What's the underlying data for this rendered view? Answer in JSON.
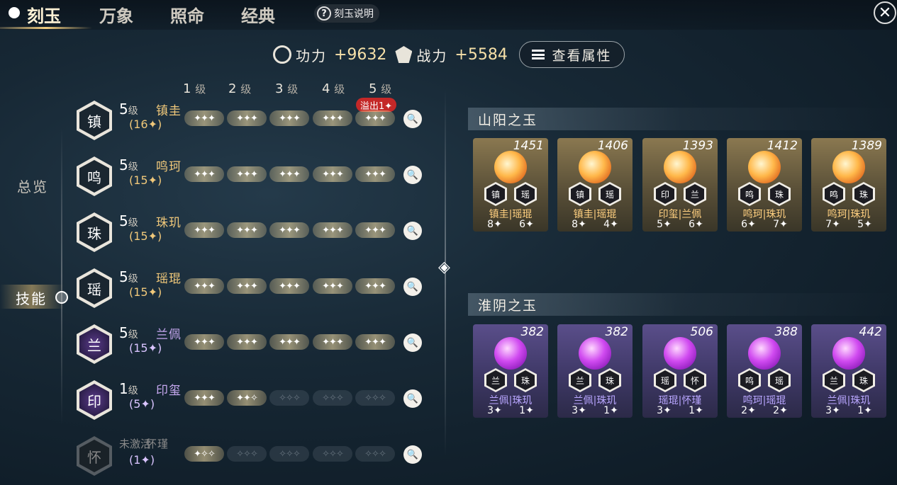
{
  "tabs": [
    {
      "label": "刻玉",
      "active": true
    },
    {
      "label": "万象",
      "active": false
    },
    {
      "label": "照命",
      "active": false
    },
    {
      "label": "经典",
      "active": false
    }
  ],
  "help_label": "刻玉说明",
  "help_icon": "?",
  "close_icon": "✕",
  "stats": {
    "gongli_label": "功力",
    "gongli_value": "+9632",
    "zhanli_label": "战力",
    "zhanli_value": "+5584",
    "attr_button": "查看属性"
  },
  "nav": {
    "overview": "总览",
    "skills": "技能"
  },
  "level_headers": [
    {
      "num": "1",
      "unit": "级"
    },
    {
      "num": "2",
      "unit": "级"
    },
    {
      "num": "3",
      "unit": "级"
    },
    {
      "num": "4",
      "unit": "级"
    },
    {
      "num": "5",
      "unit": "级"
    }
  ],
  "overflow_badge": "溢出1✦",
  "skills": [
    {
      "level": "5",
      "unit": "级",
      "name": "镇圭",
      "stars": "(16✦)",
      "filled": 15,
      "color": "gold",
      "active": true,
      "icon": "镇"
    },
    {
      "level": "5",
      "unit": "级",
      "name": "鸣珂",
      "stars": "(15✦)",
      "filled": 15,
      "color": "gold",
      "active": true,
      "icon": "鸣"
    },
    {
      "level": "5",
      "unit": "级",
      "name": "珠玑",
      "stars": "(15✦)",
      "filled": 15,
      "color": "gold",
      "active": true,
      "icon": "珠"
    },
    {
      "level": "5",
      "unit": "级",
      "name": "瑶琨",
      "stars": "(15✦)",
      "filled": 15,
      "color": "gold",
      "active": true,
      "icon": "瑶"
    },
    {
      "level": "5",
      "unit": "级",
      "name": "兰佩",
      "stars": "(15✦)",
      "filled": 15,
      "color": "purple",
      "active": true,
      "icon": "兰"
    },
    {
      "level": "1",
      "unit": "级",
      "name": "印玺",
      "stars": "(5✦)",
      "filled": 5,
      "color": "purple",
      "active": true,
      "icon": "印"
    },
    {
      "level": "未激活",
      "unit": "",
      "name": "怀瑾",
      "stars": "(1✦)",
      "filled": 1,
      "color": "purple",
      "active": false,
      "icon": "怀"
    }
  ],
  "groups": {
    "shanyang": {
      "title": "山阳之玉",
      "cards": [
        {
          "score": "1451",
          "a": "镇圭",
          "b": "瑶琨",
          "an": "8✦",
          "bn": "6✦",
          "ia": "镇",
          "ib": "瑶"
        },
        {
          "score": "1406",
          "a": "镇圭",
          "b": "瑶琨",
          "an": "8✦",
          "bn": "4✦",
          "ia": "镇",
          "ib": "瑶"
        },
        {
          "score": "1393",
          "a": "印玺",
          "b": "兰佩",
          "an": "5✦",
          "bn": "6✦",
          "ia": "印",
          "ib": "兰"
        },
        {
          "score": "1412",
          "a": "鸣珂",
          "b": "珠玑",
          "an": "6✦",
          "bn": "7✦",
          "ia": "鸣",
          "ib": "珠"
        },
        {
          "score": "1389",
          "a": "鸣珂",
          "b": "珠玑",
          "an": "7✦",
          "bn": "5✦",
          "ia": "鸣",
          "ib": "珠"
        }
      ]
    },
    "huaiyin": {
      "title": "淮阴之玉",
      "cards": [
        {
          "score": "382",
          "a": "兰佩",
          "b": "珠玑",
          "an": "3✦",
          "bn": "1✦",
          "ia": "兰",
          "ib": "珠"
        },
        {
          "score": "382",
          "a": "兰佩",
          "b": "珠玑",
          "an": "3✦",
          "bn": "1✦",
          "ia": "兰",
          "ib": "珠"
        },
        {
          "score": "506",
          "a": "瑶琨",
          "b": "怀瑾",
          "an": "3✦",
          "bn": "1✦",
          "ia": "瑶",
          "ib": "怀"
        },
        {
          "score": "388",
          "a": "鸣珂",
          "b": "瑶琨",
          "an": "2✦",
          "bn": "2✦",
          "ia": "鸣",
          "ib": "瑶"
        },
        {
          "score": "442",
          "a": "兰佩",
          "b": "珠玑",
          "an": "3✦",
          "bn": "1✦",
          "ia": "兰",
          "ib": "珠"
        }
      ]
    }
  },
  "colors": {
    "gold": "#f0c87a",
    "purple": "#c6a8f0",
    "overflow": "#c42828"
  }
}
